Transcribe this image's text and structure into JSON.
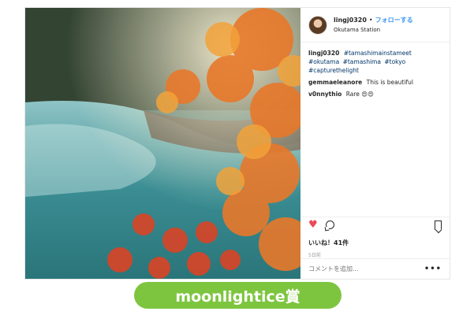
{
  "post": {
    "username": "lingj0320",
    "follow_label": "フォローする",
    "location": "Okutama Station",
    "caption": {
      "user": "lingj0320",
      "tags": [
        "#tamashimainstameet",
        "#okutama",
        "#tamashima",
        "#tokyo",
        "#capturethelight"
      ]
    },
    "comments": [
      {
        "user": "gemmaeleanore",
        "text": "This is beautiful"
      },
      {
        "user": "v0nnythio",
        "text": "Rare 😍😍"
      }
    ],
    "likes": "いいね！41件",
    "time": "5日前",
    "comment_placeholder": "コメントを追加...",
    "more_label": "•••"
  },
  "award_label": "moonlightice賞",
  "colors": {
    "like": "#ed4956",
    "follow": "#3897f0",
    "award": "#7dc53f",
    "hashtag": "#003569"
  },
  "icons": [
    "heart-icon",
    "comment-icon",
    "bookmark-icon",
    "more-options-icon"
  ]
}
